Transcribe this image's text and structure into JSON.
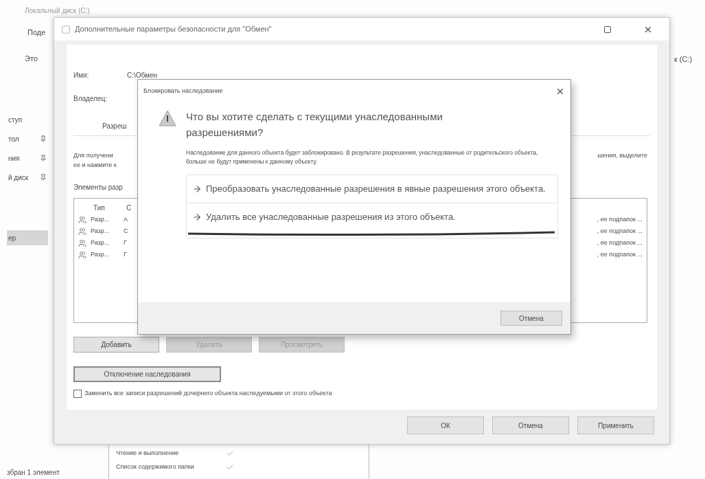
{
  "explorer": {
    "drive_title": "Локальный диск (C:)",
    "ribbon_tab": "Поде",
    "breadcrumb": "Это",
    "right_path": "к (C:)",
    "nav_items": [
      {
        "label": "ступ",
        "pinned": false,
        "selected": false
      },
      {
        "label": "тол",
        "pinned": true,
        "selected": false
      },
      {
        "label": "ния",
        "pinned": true,
        "selected": false
      },
      {
        "label": "й диск",
        "pinned": true,
        "selected": false
      },
      {
        "label": "ер",
        "pinned": false,
        "selected": true
      }
    ],
    "status": "збран 1 элемент",
    "permissions": [
      {
        "label": "Чтение и выполнение",
        "checked": true
      },
      {
        "label": "Список содержимого папки",
        "checked": true
      }
    ]
  },
  "window": {
    "title": "Дополнительные параметры безопасности  для \"Обмен\"",
    "name_label": "Имя:",
    "name_value": "C:\\Обмен",
    "owner_label": "Владелец:",
    "tab": "Разреш",
    "hint_left": [
      "Для получени",
      "ее и нажмите к"
    ],
    "hint_right": "шения, выделите",
    "entries_label": "Элементы разр",
    "columns": [
      "Тип",
      "С"
    ],
    "rows": [
      {
        "type": "Разр...",
        "col_2": "А",
        "tail": ", ее подпапок ..."
      },
      {
        "type": "Разр...",
        "col_2": "С",
        "tail": ", ее подпапок ..."
      },
      {
        "type": "Разр...",
        "col_2": "Г",
        "tail": ", ее подпапок ..."
      },
      {
        "type": "Разр...",
        "col_2": "Г",
        "tail": ", ее подпапок ..."
      }
    ],
    "buttons": [
      {
        "label": "Добавить",
        "disabled": false
      },
      {
        "label": "Удалить",
        "disabled": true
      },
      {
        "label": "Просмотреть",
        "disabled": true
      }
    ],
    "inheritance_button": "Отключение наследования",
    "replace_checkbox": {
      "label": "Заменить все записи разрешений дочернего объекта наследуемыми от этого объекта",
      "checked": false
    },
    "footer_buttons": [
      "ОК",
      "Отмена",
      "Применить"
    ]
  },
  "dialog": {
    "title": "Блокировать наследование",
    "heading": "Что вы хотите сделать с текущими унаследованными разрешениями?",
    "body": "Наследование для данного объекта будет заблокировано. В результате разрешения, унаследованные от родительского объекта, больше не будут применены к данному объекту.",
    "options": [
      {
        "label": "Преобразовать унаследованные разрешения в явные разрешения этого объекта.",
        "underlined": false
      },
      {
        "label": "Удалить все унаследованные разрешения из этого объекта.",
        "underlined": true
      }
    ],
    "cancel": "Отмена"
  }
}
